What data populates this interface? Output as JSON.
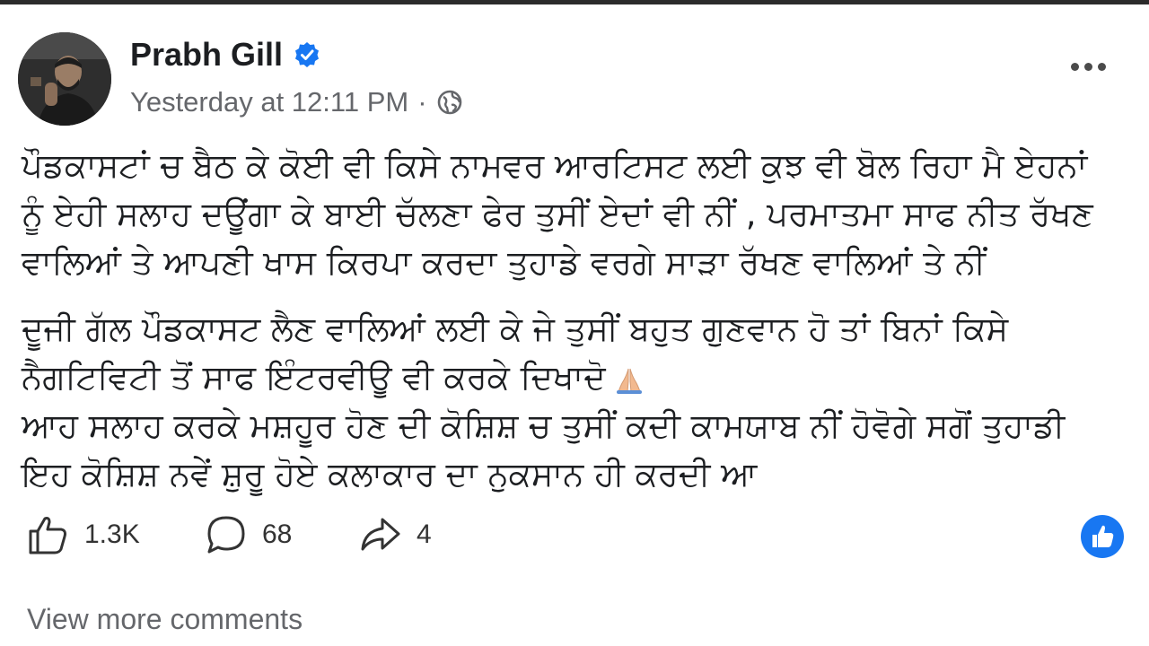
{
  "post": {
    "author_name": "Prabh Gill",
    "timestamp": "Yesterday at 12:11 PM",
    "separator": "·",
    "privacy_icon": "globe-icon",
    "verified_icon": "verified-badge-icon",
    "more_icon": "more-options-icon",
    "paragraphs": [
      {
        "lines": [
          "ਪੌਡਕਾਸਟਾਂ ਚ ਬੈਠ ਕੇ ਕੋਈ ਵੀ ਕਿਸੇ ਨਾਮਵਰ ਆਰਟਿਸਟ ਲਈ ਕੁਝ ਵੀ ਬੋਲ ਰਿਹਾ ਮੈ ਏਹਨਾਂ",
          "ਨੂੰ ਏਹੀ ਸਲਾਹ ਦਊਂਗਾ ਕੇ ਬਾਈ ਚੱਲਣਾ ਫੇਰ ਤੁਸੀਂ ਏਦਾਂ ਵੀ ਨੀਂ , ਪਰਮਾਤਮਾ ਸਾਫ ਨੀਤ ਰੱਖਣ",
          "ਵਾਲਿਆਂ ਤੇ ਆਪਣੀ ਖਾਸ ਕਿਰਪਾ ਕਰਦਾ ਤੁਹਾਡੇ ਵਰਗੇ ਸਾੜਾ ਰੱਖਣ ਵਾਲਿਆਂ ਤੇ ਨੀਂ"
        ]
      },
      {
        "lines": [
          "ਦੂਜੀ ਗੱਲ ਪੌਡਕਾਸਟ ਲੈਣ ਵਾਲਿਆਂ ਲਈ ਕੇ ਜੇ ਤੁਸੀਂ ਬਹੁਤ ਗੁਣਵਾਨ ਹੋ ਤਾਂ ਬਿਨਾਂ ਕਿਸੇ",
          "ਨੈਗਟਿਵਿਟੀ ਤੋਂ ਸਾਫ ਇੰਟਰਵੀਊ ਵੀ ਕਰਕੇ ਦਿਖਾਦੋ",
          "ਆਹ ਸਲਾਹ ਕਰਕੇ ਮਸ਼ਹੂਰ ਹੋਣ ਦੀ ਕੋਸ਼ਿਸ਼ ਚ ਤੁਸੀਂ ਕਦੀ ਕਾਮਯਾਬ ਨੀਂ ਹੋਵੋਗੇ ਸਗੋਂ ਤੁਹਾਡੀ",
          "ਇਹ ਕੋਸ਼ਿਸ਼ ਨਵੇਂ ਸ਼ੁਰੂ ਹੋਏ ਕਲਾਕਾਰ ਦਾ ਨੁਕਸਾਨ ਹੀ ਕਰਦੀ ਆ"
        ]
      }
    ],
    "emoji_icon": "folded-hands-icon"
  },
  "actions": {
    "like_count": "1.3K",
    "comment_count": "68",
    "share_count": "4",
    "like_icon": "thumbs-up-icon",
    "comment_icon": "comment-icon",
    "share_icon": "share-icon",
    "reaction_badge_icon": "like-reaction-icon"
  },
  "footer": {
    "view_more_label": "View more comments"
  },
  "colors": {
    "accent_blue": "#1877f2",
    "secondary_text": "#65676b"
  }
}
